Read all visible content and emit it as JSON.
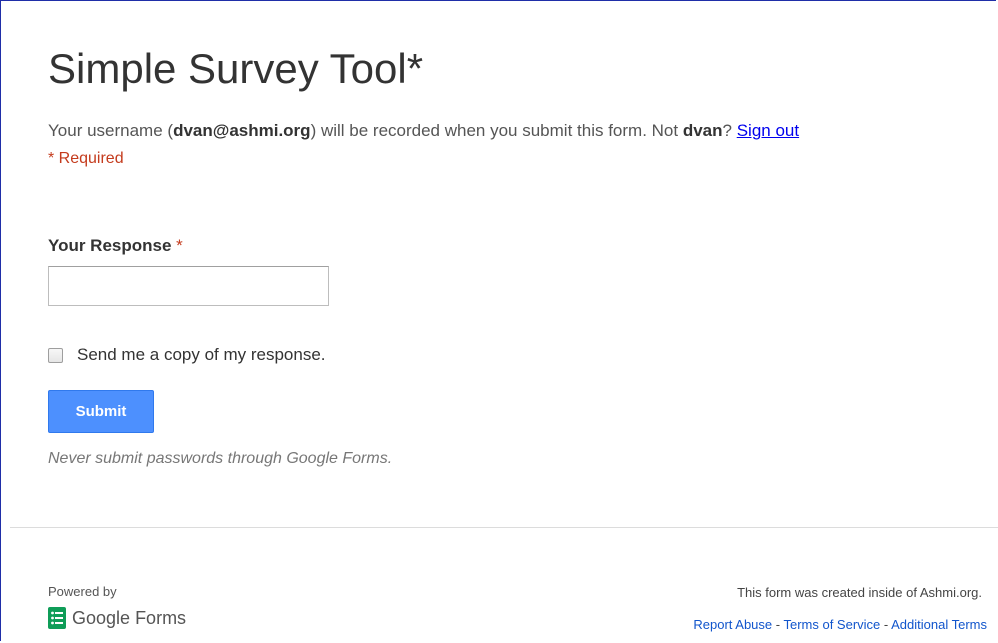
{
  "form": {
    "title": "Simple Survey Tool*",
    "user_prefix": "Your username (",
    "user_email": "dvan@ashmi.org",
    "user_middle": ") will be recorded when you submit this form. Not ",
    "user_short": "dvan",
    "user_qmark": "? ",
    "sign_out_label": "Sign out",
    "required_note": "* Required"
  },
  "question": {
    "title": "Your Response",
    "required_star": "*",
    "input_value": ""
  },
  "copy_checkbox": {
    "label": "Send me a copy of my response.",
    "checked": false
  },
  "submit": {
    "label": "Submit"
  },
  "warning": "Never submit passwords through Google Forms.",
  "footer": {
    "powered_by": "Powered by",
    "brand_google": "Google",
    "brand_forms": "Forms",
    "created_note": "This form was created inside of Ashmi.org.",
    "report_abuse": "Report Abuse",
    "separator": " - ",
    "terms": "Terms of Service",
    "additional_terms": "Additional Terms"
  },
  "colors": {
    "accent_blue": "#4d90fe",
    "required_red": "#c43b1d",
    "forms_green": "#0f9d58",
    "link_blue": "#1155cc"
  },
  "icons": {
    "brand": "google-forms-icon"
  }
}
